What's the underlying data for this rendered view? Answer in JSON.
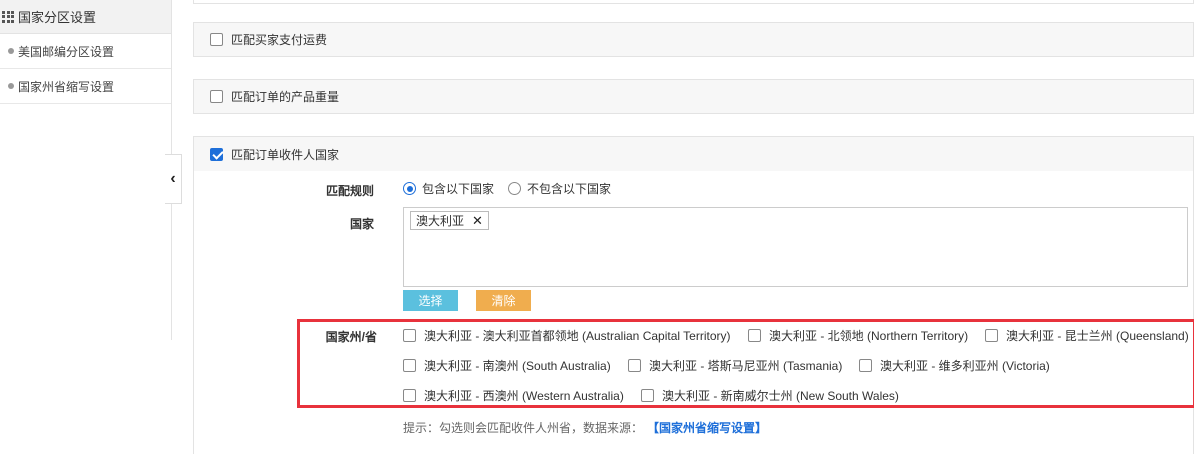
{
  "sidebar": {
    "title": "国家分区设置",
    "items": [
      {
        "label": "美国邮编分区设置"
      },
      {
        "label": "国家州省缩写设置"
      }
    ]
  },
  "panels": {
    "pay_shipping": {
      "label": "匹配买家支付运费",
      "checked": false
    },
    "product_weight": {
      "label": "匹配订单的产品重量",
      "checked": false
    },
    "recipient_country": {
      "label": "匹配订单收件人国家",
      "checked": true
    }
  },
  "form": {
    "rule_label": "匹配规则",
    "rule_options": [
      {
        "label": "包含以下国家",
        "selected": true
      },
      {
        "label": "不包含以下国家",
        "selected": false
      }
    ],
    "country_label": "国家",
    "selected_tag": "澳大利亚",
    "tag_remove": "✕",
    "select_button": "选择",
    "clear_button": "清除",
    "states_label": "国家州/省",
    "states": [
      {
        "label": "澳大利亚 - 澳大利亚首都领地 (Australian Capital Territory)",
        "checked": false
      },
      {
        "label": "澳大利亚 - 北领地 (Northern Territory)",
        "checked": false
      },
      {
        "label": "澳大利亚 - 昆士兰州 (Queensland)",
        "checked": false
      },
      {
        "label": "澳大利亚 - 南澳州 (South Australia)",
        "checked": false
      },
      {
        "label": "澳大利亚 - 塔斯马尼亚州 (Tasmania)",
        "checked": false
      },
      {
        "label": "澳大利亚 - 维多利亚州 (Victoria)",
        "checked": false
      },
      {
        "label": "澳大利亚 - 西澳州 (Western Australia)",
        "checked": false
      },
      {
        "label": "澳大利亚 - 新南威尔士州 (New South Wales)",
        "checked": false
      }
    ],
    "hint_text": "提示：勾选则会匹配收件人州省，数据来源：",
    "hint_link": "【国家州省缩写设置】"
  },
  "colors": {
    "accent": "#1e6fd9",
    "select_button": "#5bc0de",
    "clear_button": "#f0ad4e",
    "highlight_border": "#e8323c"
  },
  "icons": {
    "sidebar_header": "grid-icon",
    "collapse": "chevron-left-icon",
    "tag_remove": "close-icon"
  }
}
